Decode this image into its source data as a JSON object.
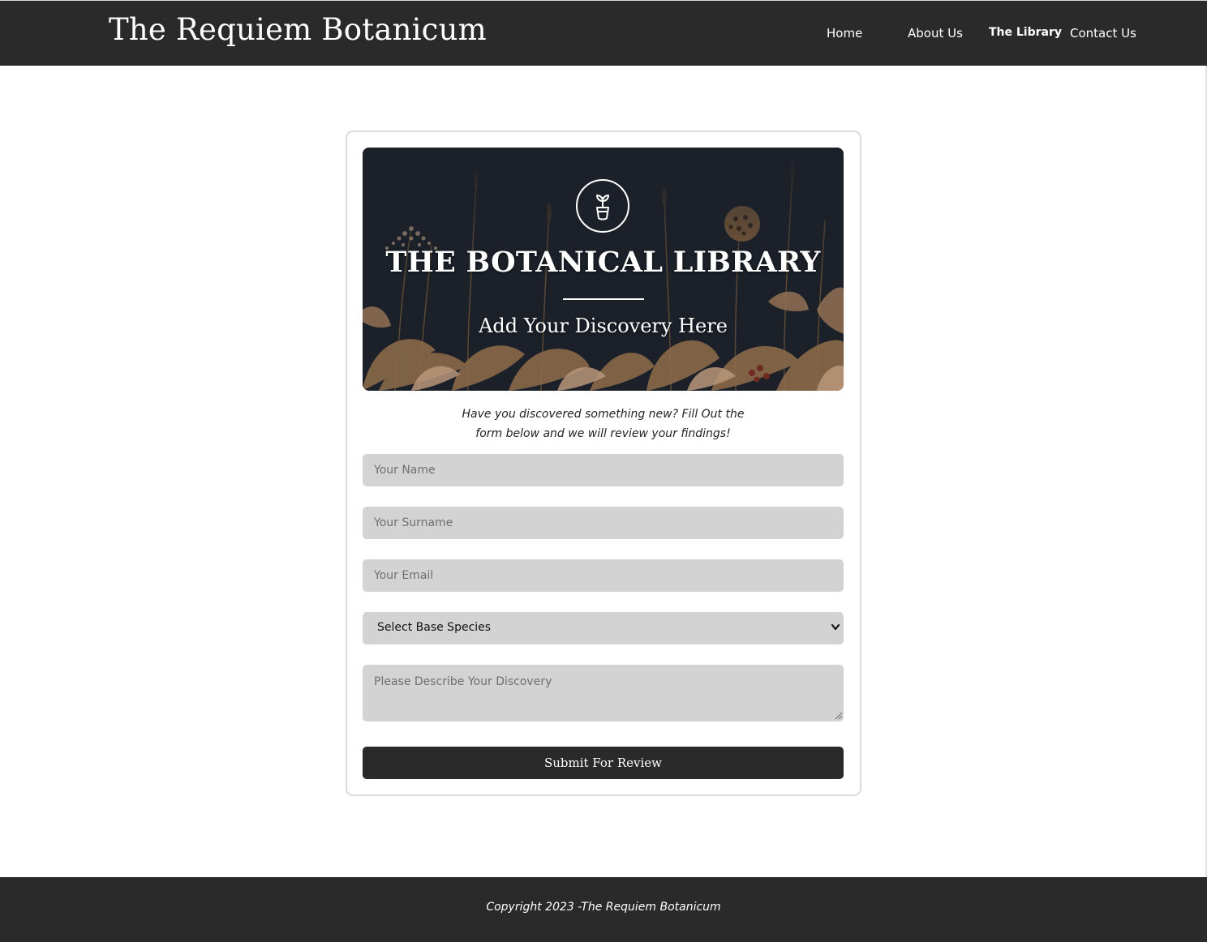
{
  "header": {
    "site_title": "The Requiem Botanicum",
    "nav": {
      "home": "Home",
      "about": "About Us",
      "library": "The Library",
      "contact": "Contact Us"
    },
    "active_nav": "library"
  },
  "banner": {
    "title": "THE BOTANICAL LIBRARY",
    "subtitle": "Add Your Discovery Here",
    "emblem_icon": "sprout-icon"
  },
  "intro": {
    "line1": "Have you discovered something new? Fill Out the",
    "line2": "form below and we will review your findings!"
  },
  "form": {
    "name_placeholder": "Your Name",
    "surname_placeholder": "Your Surname",
    "email_placeholder": "Your Email",
    "species_selected": "Select Base Species",
    "description_placeholder": "Please Describe Your Discovery",
    "submit_label": "Submit For Review"
  },
  "footer": {
    "copyright": "Copyright 2023 -The Requiem Botanicum"
  },
  "colors": {
    "header_bg": "#2a2a2a",
    "field_bg": "#d3d3d3",
    "banner_bg": "#1b2029",
    "accent_foliage": "#8a6a4a"
  }
}
